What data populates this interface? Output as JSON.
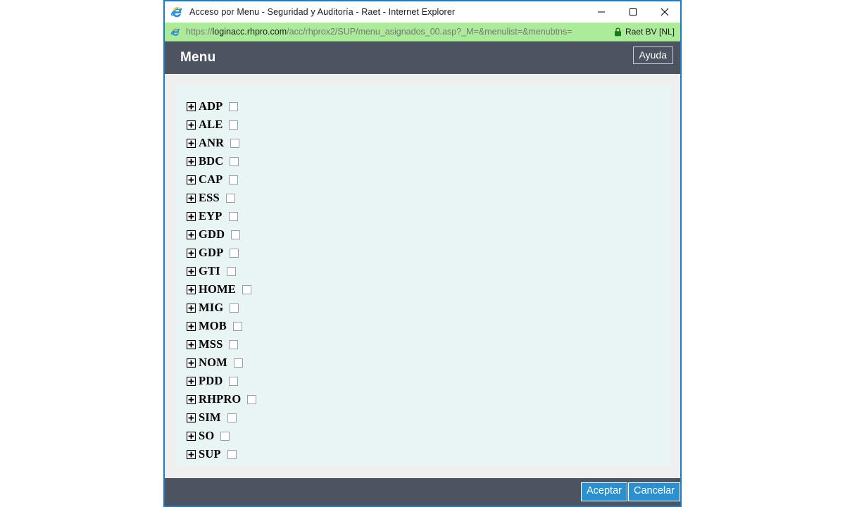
{
  "window": {
    "title": "Acceso por Menu - Seguridad y Auditoría - Raet - Internet Explorer",
    "app_icon": "internet-explorer-icon",
    "minimize_label": "—",
    "maximize_label": "▢",
    "close_label": "✕"
  },
  "address_bar": {
    "icon": "internet-explorer-icon",
    "scheme": "https://",
    "host": "loginacc.rhpro.com",
    "path": "/acc/rhprox2/SUP/menu_asignados_00.asp?_M=&menulist=&menubtns=",
    "full_url": "https://loginacc.rhpro.com/acc/rhprox2/SUP/menu_asignados_00.asp?_M=&menulist=&menubtns=",
    "lock_icon": "lock-icon",
    "certificate_name": "Raet BV [NL]"
  },
  "header": {
    "title": "Menu",
    "help_label": "Ayuda",
    "background_color": "#4c5361"
  },
  "menu": {
    "expand_icon": "plus-box-icon",
    "items": [
      {
        "label": "ADP",
        "checked": false
      },
      {
        "label": "ALE",
        "checked": false
      },
      {
        "label": "ANR",
        "checked": false
      },
      {
        "label": "BDC",
        "checked": false
      },
      {
        "label": "CAP",
        "checked": false
      },
      {
        "label": "ESS",
        "checked": false
      },
      {
        "label": "EYP",
        "checked": false
      },
      {
        "label": "GDD",
        "checked": false
      },
      {
        "label": "GDP",
        "checked": false
      },
      {
        "label": "GTI",
        "checked": false
      },
      {
        "label": "HOME",
        "checked": false
      },
      {
        "label": "MIG",
        "checked": false
      },
      {
        "label": "MOB",
        "checked": false
      },
      {
        "label": "MSS",
        "checked": false
      },
      {
        "label": "NOM",
        "checked": false
      },
      {
        "label": "PDD",
        "checked": false
      },
      {
        "label": "RHPRO",
        "checked": false
      },
      {
        "label": "SIM",
        "checked": false
      },
      {
        "label": "SO",
        "checked": false
      },
      {
        "label": "SUP",
        "checked": false
      }
    ],
    "panel_background": "#e9f5f4"
  },
  "footer": {
    "accept_label": "Aceptar",
    "cancel_label": "Cancelar",
    "button_color": "#2b90d0",
    "background_color": "#4c5361"
  }
}
